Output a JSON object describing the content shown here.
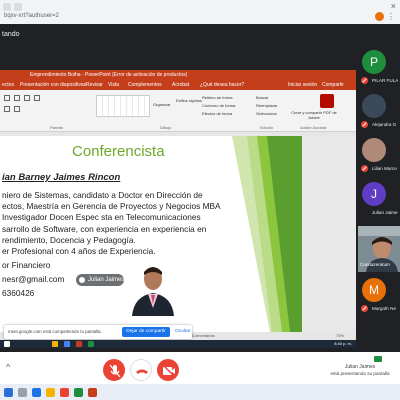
{
  "browser": {
    "url_text": "bqxv-xrt?authuser=2",
    "close_glyph": "×",
    "menu_glyph": "⋮"
  },
  "meet": {
    "presenter_label": "tando"
  },
  "powerpoint": {
    "window_title": "Emprendimiento Boiha - PowerPoint (Error de activación de productos)",
    "tabs": [
      "ectos",
      "Presentación con diapositivas",
      "Revisar",
      "Vista",
      "Complementos",
      "Acrobat",
      "¿Qué desea hacer?",
      "Iniciar sesión",
      "Compartir"
    ],
    "ribbon": {
      "groups": [
        "Párrafo",
        "Dibujo",
        "Edición",
        "Adobe Acrobat"
      ],
      "items": [
        "Organizar",
        "Estilos rápidos",
        "Relleno de forma",
        "Contorno de forma",
        "Efectos de forma",
        "Buscar",
        "Reemplazar",
        "Seleccionar",
        "Crear y compartir PDF de Adobe"
      ]
    },
    "status_notes": "Comentarios",
    "status_zoom": "75%",
    "taskbar_time": "8:40 p. m."
  },
  "slide": {
    "title": "Conferencista",
    "name": "ian Barney Jaimes Rincon",
    "bio_lines": [
      "niero de Sistemas, candidato a Doctor en Dirección de",
      "ectos, Maestría en Gerencia de Proyectos y Negocios MBA",
      " Investigador Docen   Espec   sta en Telecomunicaciones",
      "sarrollo de Software, con experiencia en experiencia en",
      "rendimiento, Docencia y Pedagogía."
    ],
    "line_experience": "er Profesional con 4 años de Experiencia.",
    "line_role": "or Financiero",
    "line_email": "nesr@gmail.com",
    "line_phone": "6360426"
  },
  "speaker_badge": "Julian Jaimes",
  "share_banner": {
    "message": "meet.google.com está compartiendo tu pantalla.",
    "stop_label": "Dejar de compartir",
    "hide_label": "Ocultar"
  },
  "participants": [
    {
      "initial": "P",
      "name": "PILAR FULA",
      "color": "#1e8e3e"
    },
    {
      "initial": "",
      "name": "Alejandra G",
      "color": "#5f6368"
    },
    {
      "initial": "",
      "name": "Lilian Marce",
      "color": "#8a6a5a"
    },
    {
      "initial": "J",
      "name": "Julian Jaime",
      "color": "#5f3dc4"
    },
    {
      "initial": "",
      "name": "Cunitazeratum",
      "color": "#6a7a80"
    },
    {
      "initial": "M",
      "name": "Margoth Ne",
      "color": "#e8710a"
    }
  ],
  "bottom_bar": {
    "presenting_name": "Julian Jaimes",
    "presenting_status": "está presentando su pantalla"
  },
  "colors": {
    "powerpoint_red": "#c43e1c",
    "slide_title_green": "#6ca82a",
    "meet_red": "#ea4335",
    "meet_blue": "#1a73e8"
  }
}
